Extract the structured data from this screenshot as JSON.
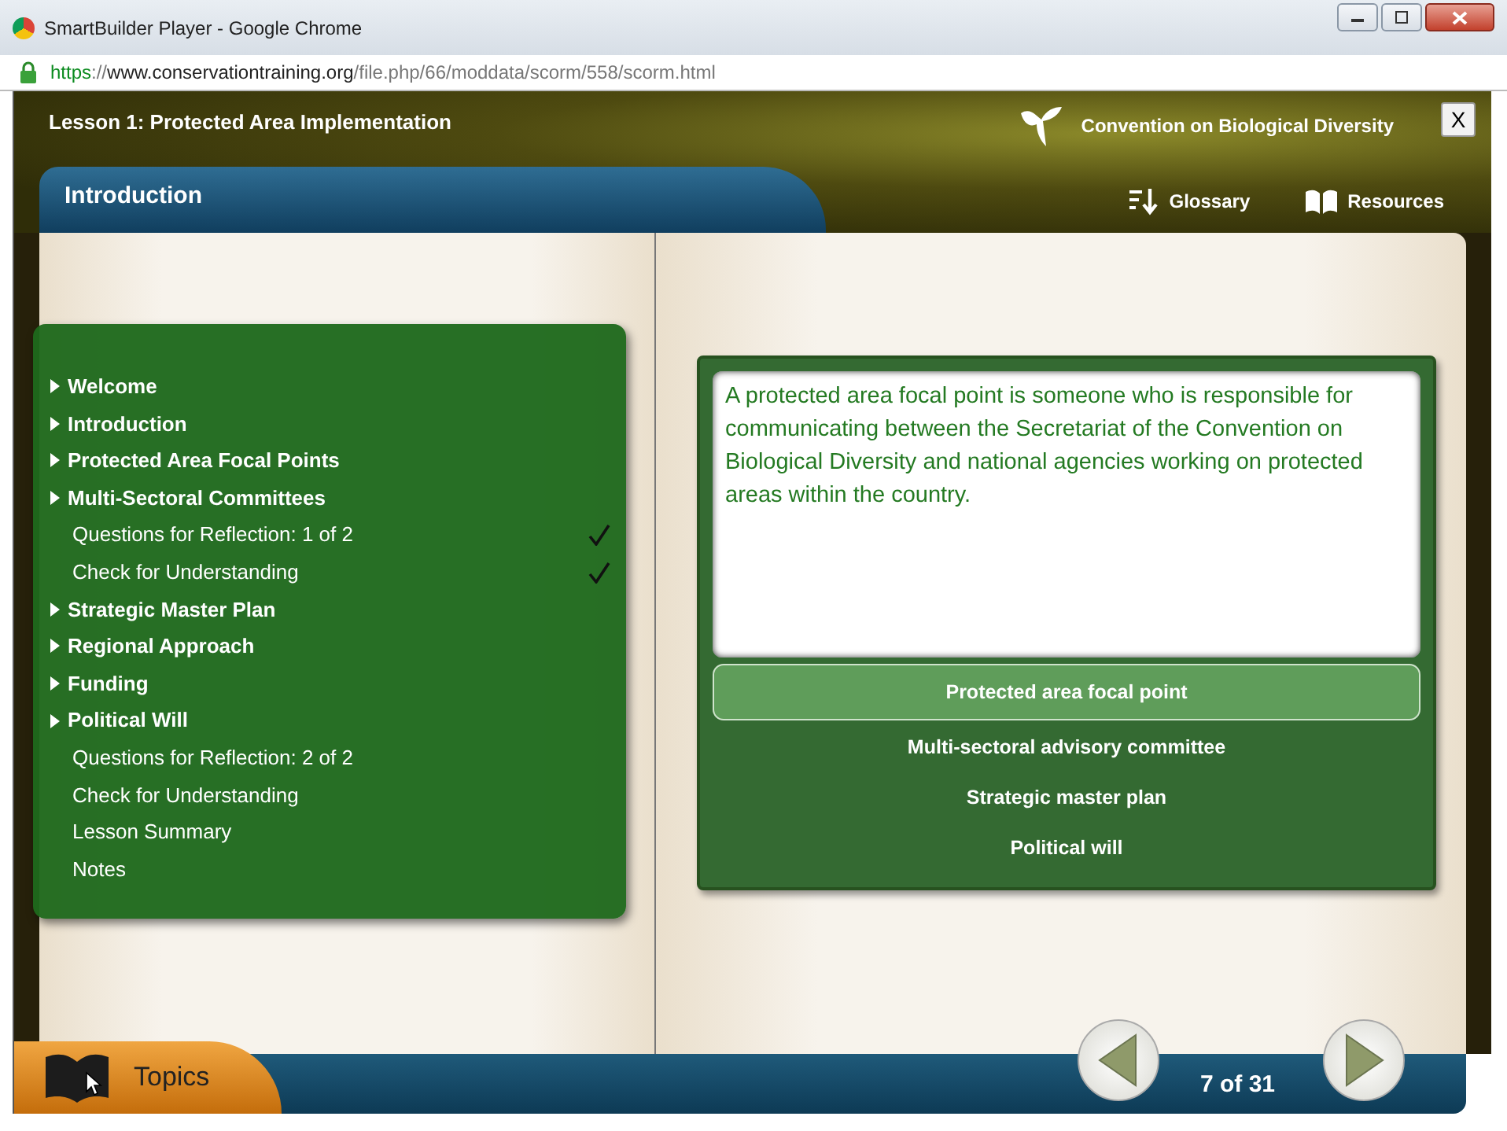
{
  "window": {
    "title": "SmartBuilder Player - Google Chrome"
  },
  "address_bar": {
    "scheme": "https",
    "separator": "://",
    "host": "www.conservationtraining.org",
    "path": "/file.php/66/moddata/scorm/558/scorm.html"
  },
  "header": {
    "lesson_title": "Lesson 1: Protected Area Implementation",
    "organization": "Convention on Biological Diversity",
    "close_label": "X"
  },
  "section_tab": "Introduction",
  "tools": [
    {
      "label": "Glossary",
      "kind": "glossary"
    },
    {
      "label": "Resources",
      "kind": "resources"
    }
  ],
  "topics_menu": {
    "items": [
      {
        "label": "Welcome",
        "kind": "section"
      },
      {
        "label": "Introduction",
        "kind": "section"
      },
      {
        "label": "Protected Area Focal Points",
        "kind": "section"
      },
      {
        "label": "Multi-Sectoral Committees",
        "kind": "section"
      },
      {
        "label": "Questions for Reflection: 1 of 2",
        "kind": "page",
        "checked": true
      },
      {
        "label": "Check for Understanding",
        "kind": "page",
        "checked": true
      },
      {
        "label": "Strategic Master Plan",
        "kind": "section"
      },
      {
        "label": "Regional Approach",
        "kind": "section"
      },
      {
        "label": "Funding",
        "kind": "section"
      },
      {
        "label": "Political Will",
        "kind": "section"
      },
      {
        "label": "Questions for Reflection: 2 of 2",
        "kind": "page",
        "checked": false
      },
      {
        "label": "Check for Understanding",
        "kind": "page",
        "checked": false
      },
      {
        "label": "Lesson Summary",
        "kind": "page",
        "checked": false
      },
      {
        "label": "Notes",
        "kind": "page",
        "checked": false
      }
    ]
  },
  "definition": {
    "text": "A protected area focal point is someone who is responsible for communicating between the Secretariat of the Convention on Biological Diversity and national agencies working on protected areas within the country.",
    "terms": [
      {
        "label": "Protected area focal point",
        "selected": true
      },
      {
        "label": "Multi-sectoral advisory committee",
        "selected": false
      },
      {
        "label": "Strategic master plan",
        "selected": false
      },
      {
        "label": "Political will",
        "selected": false
      }
    ]
  },
  "footer": {
    "topics_label": "Topics",
    "page_counter": "7 of 31"
  }
}
